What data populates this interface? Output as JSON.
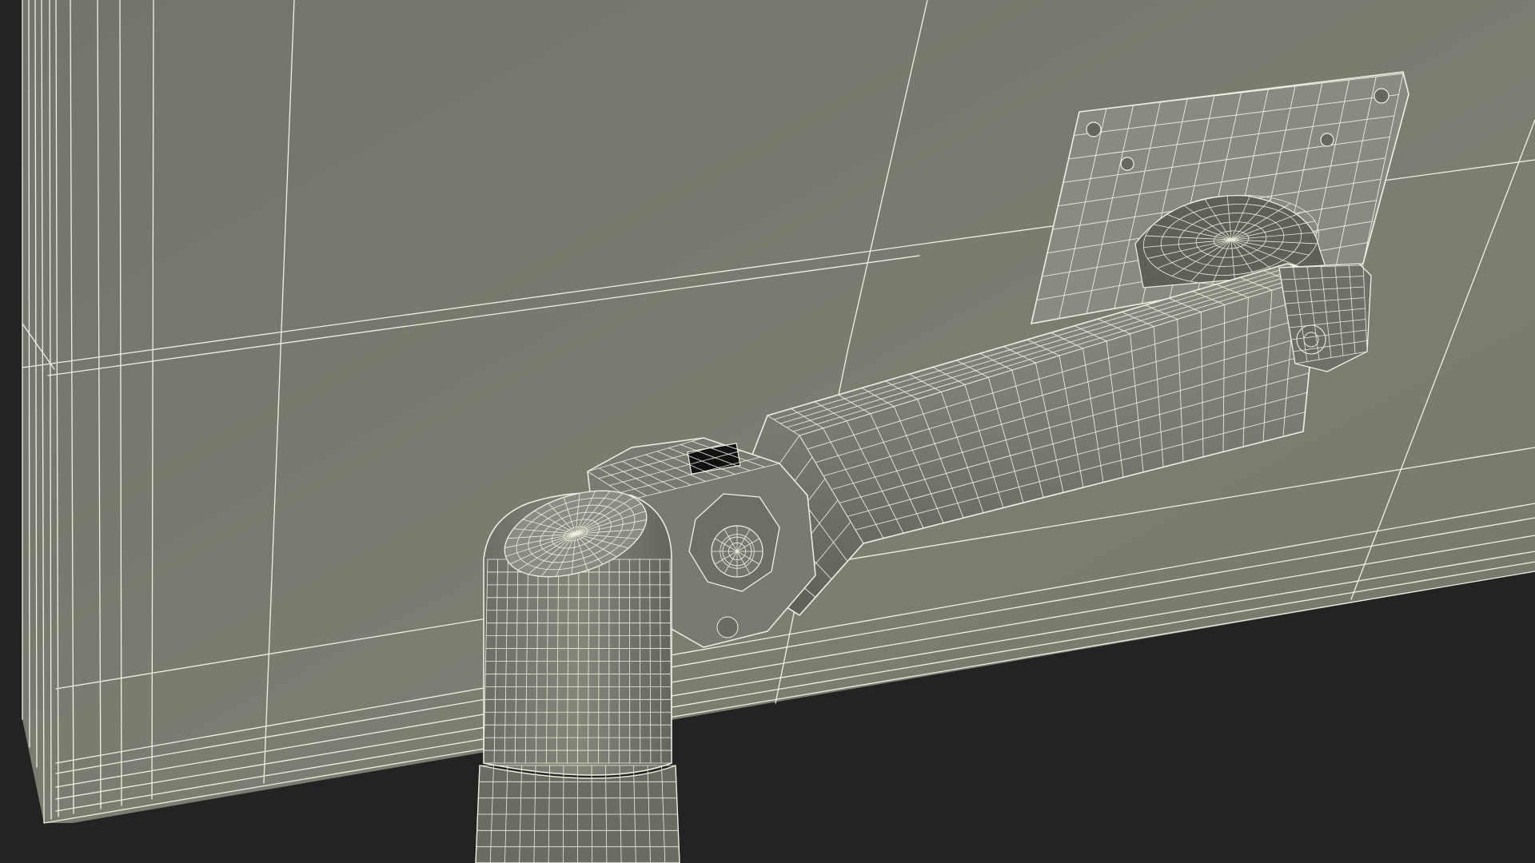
{
  "scene": {
    "colors": {
      "background": "#232323",
      "monitor_back": "#797a6e",
      "monitor_shadow": "#6c6d62",
      "arm_body": "#7b7c70",
      "arm_dark": "#5f6057",
      "wire_main": "#f2f1e4",
      "wire_dense": "#e8e7d8"
    }
  }
}
